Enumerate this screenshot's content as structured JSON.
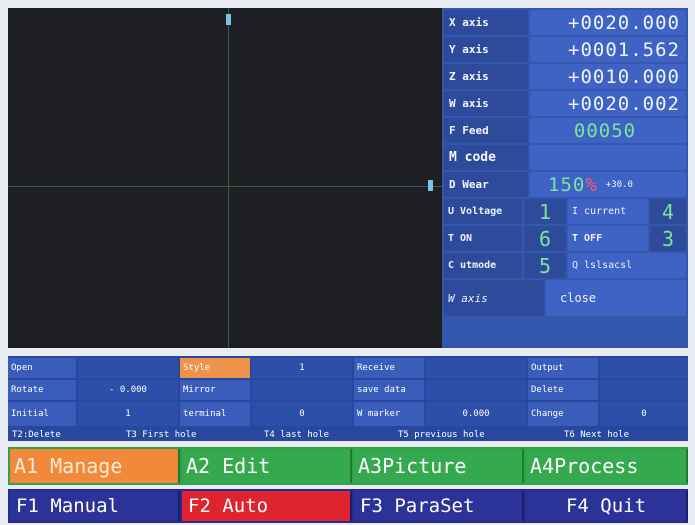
{
  "axes": [
    {
      "label": "X axis",
      "value": "+0020.000"
    },
    {
      "label": "Y axis",
      "value": "+0001.562"
    },
    {
      "label": "Z axis",
      "value": "+0010.000"
    },
    {
      "label": "W axis",
      "value": "+0020.002"
    }
  ],
  "feed": {
    "label": "F Feed",
    "value": "00050"
  },
  "mcode": {
    "label": "M code",
    "value": ""
  },
  "dwear": {
    "label": "D Wear",
    "value": "150",
    "unit": "%",
    "extra": "+30.0"
  },
  "voltage": {
    "label": "U Voltage",
    "value": "1"
  },
  "current": {
    "label": "I current",
    "value": "4"
  },
  "ton": {
    "label": "T ON",
    "value": "6"
  },
  "toff": {
    "label": "T OFF",
    "value": "3"
  },
  "cutmode": {
    "label": "C utmode",
    "value": "5"
  },
  "lsalsaconsl": {
    "label": "Q lslsacsl",
    "value": ""
  },
  "waxis": {
    "label": "W axis",
    "value": "close"
  },
  "params": {
    "open": "Open",
    "style": "Style",
    "style_value": "1",
    "receive": "Receive",
    "output": "Output",
    "rotate": "Rotate",
    "rotate_value": "-  0.000",
    "mirror": "Mirror",
    "save_data": "save data",
    "delete": "Delete",
    "initial": "Initial",
    "initial_value": "1",
    "terminal": "terminal",
    "terminal_value": "0",
    "w_marker": "W marker",
    "w_marker_value": "0.000",
    "change": "Change",
    "change_value": "0"
  },
  "shortcuts": [
    "T2:Delete",
    "T3 First hole",
    "T4 last hole",
    "T5 previous hole",
    "T6 Next hole"
  ],
  "modes": [
    "A1 Manage",
    "A2 Edit",
    "A3Picture",
    "A4Process"
  ],
  "functions": [
    "F1 Manual",
    "F2 Auto",
    "F3 ParaSet",
    "F4 Quit"
  ]
}
